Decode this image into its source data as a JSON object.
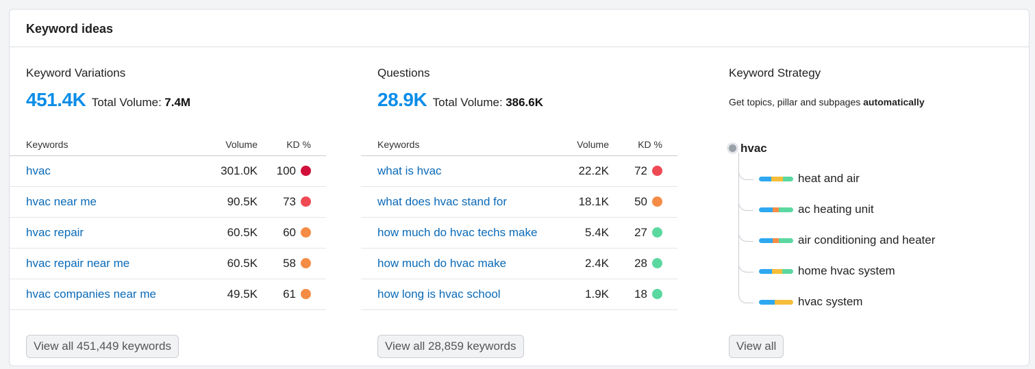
{
  "card": {
    "title": "Keyword ideas"
  },
  "colors": {
    "kd_very_hard": "#d0103a",
    "kd_hard": "#ef4a54",
    "kd_difficult": "#f58c45",
    "kd_easy": "#5ad8a0",
    "link": "#0a6ab8",
    "accent": "#0b8de8",
    "bar_blue": "#2ea8f0",
    "bar_yellow": "#f6bd3a",
    "bar_orange": "#f58c45",
    "bar_green": "#5ad8a0"
  },
  "variations": {
    "title": "Keyword Variations",
    "count": "451.4K",
    "total_label": "Total Volume:",
    "total_value": "7.4M",
    "headers": {
      "keyword": "Keywords",
      "volume": "Volume",
      "kd": "KD %"
    },
    "rows": [
      {
        "keyword": "hvac",
        "volume": "301.0K",
        "kd": "100",
        "kd_level": "kd_very_hard"
      },
      {
        "keyword": "hvac near me",
        "volume": "90.5K",
        "kd": "73",
        "kd_level": "kd_hard"
      },
      {
        "keyword": "hvac repair",
        "volume": "60.5K",
        "kd": "60",
        "kd_level": "kd_difficult"
      },
      {
        "keyword": "hvac repair near me",
        "volume": "60.5K",
        "kd": "58",
        "kd_level": "kd_difficult"
      },
      {
        "keyword": "hvac companies near me",
        "volume": "49.5K",
        "kd": "61",
        "kd_level": "kd_difficult"
      }
    ],
    "button": "View all 451,449 keywords"
  },
  "questions": {
    "title": "Questions",
    "count": "28.9K",
    "total_label": "Total Volume:",
    "total_value": "386.6K",
    "headers": {
      "keyword": "Keywords",
      "volume": "Volume",
      "kd": "KD %"
    },
    "rows": [
      {
        "keyword": "what is hvac",
        "volume": "22.2K",
        "kd": "72",
        "kd_level": "kd_hard"
      },
      {
        "keyword": "what does hvac stand for",
        "volume": "18.1K",
        "kd": "50",
        "kd_level": "kd_difficult"
      },
      {
        "keyword": "how much do hvac techs make",
        "volume": "5.4K",
        "kd": "27",
        "kd_level": "kd_easy"
      },
      {
        "keyword": "how much do hvac make",
        "volume": "2.4K",
        "kd": "28",
        "kd_level": "kd_easy"
      },
      {
        "keyword": "how long is hvac school",
        "volume": "1.9K",
        "kd": "18",
        "kd_level": "kd_easy"
      }
    ],
    "button": "View all 28,859 keywords"
  },
  "strategy": {
    "title": "Keyword Strategy",
    "subtitle_text": "Get topics, pillar and subpages ",
    "subtitle_bold": "automatically",
    "root": "hvac",
    "topics": [
      {
        "label": "heat and air",
        "bar": [
          [
            "bar_blue",
            35
          ],
          [
            "bar_yellow",
            35
          ],
          [
            "bar_green",
            30
          ]
        ]
      },
      {
        "label": "ac heating unit",
        "bar": [
          [
            "bar_blue",
            40
          ],
          [
            "bar_orange",
            18
          ],
          [
            "bar_green",
            42
          ]
        ]
      },
      {
        "label": "air conditioning and heater",
        "bar": [
          [
            "bar_blue",
            40
          ],
          [
            "bar_orange",
            18
          ],
          [
            "bar_green",
            42
          ]
        ]
      },
      {
        "label": "home hvac system",
        "bar": [
          [
            "bar_blue",
            38
          ],
          [
            "bar_yellow",
            30
          ],
          [
            "bar_green",
            32
          ]
        ]
      },
      {
        "label": "hvac system",
        "bar": [
          [
            "bar_blue",
            45
          ],
          [
            "bar_yellow",
            55
          ]
        ]
      }
    ],
    "button": "View all"
  }
}
